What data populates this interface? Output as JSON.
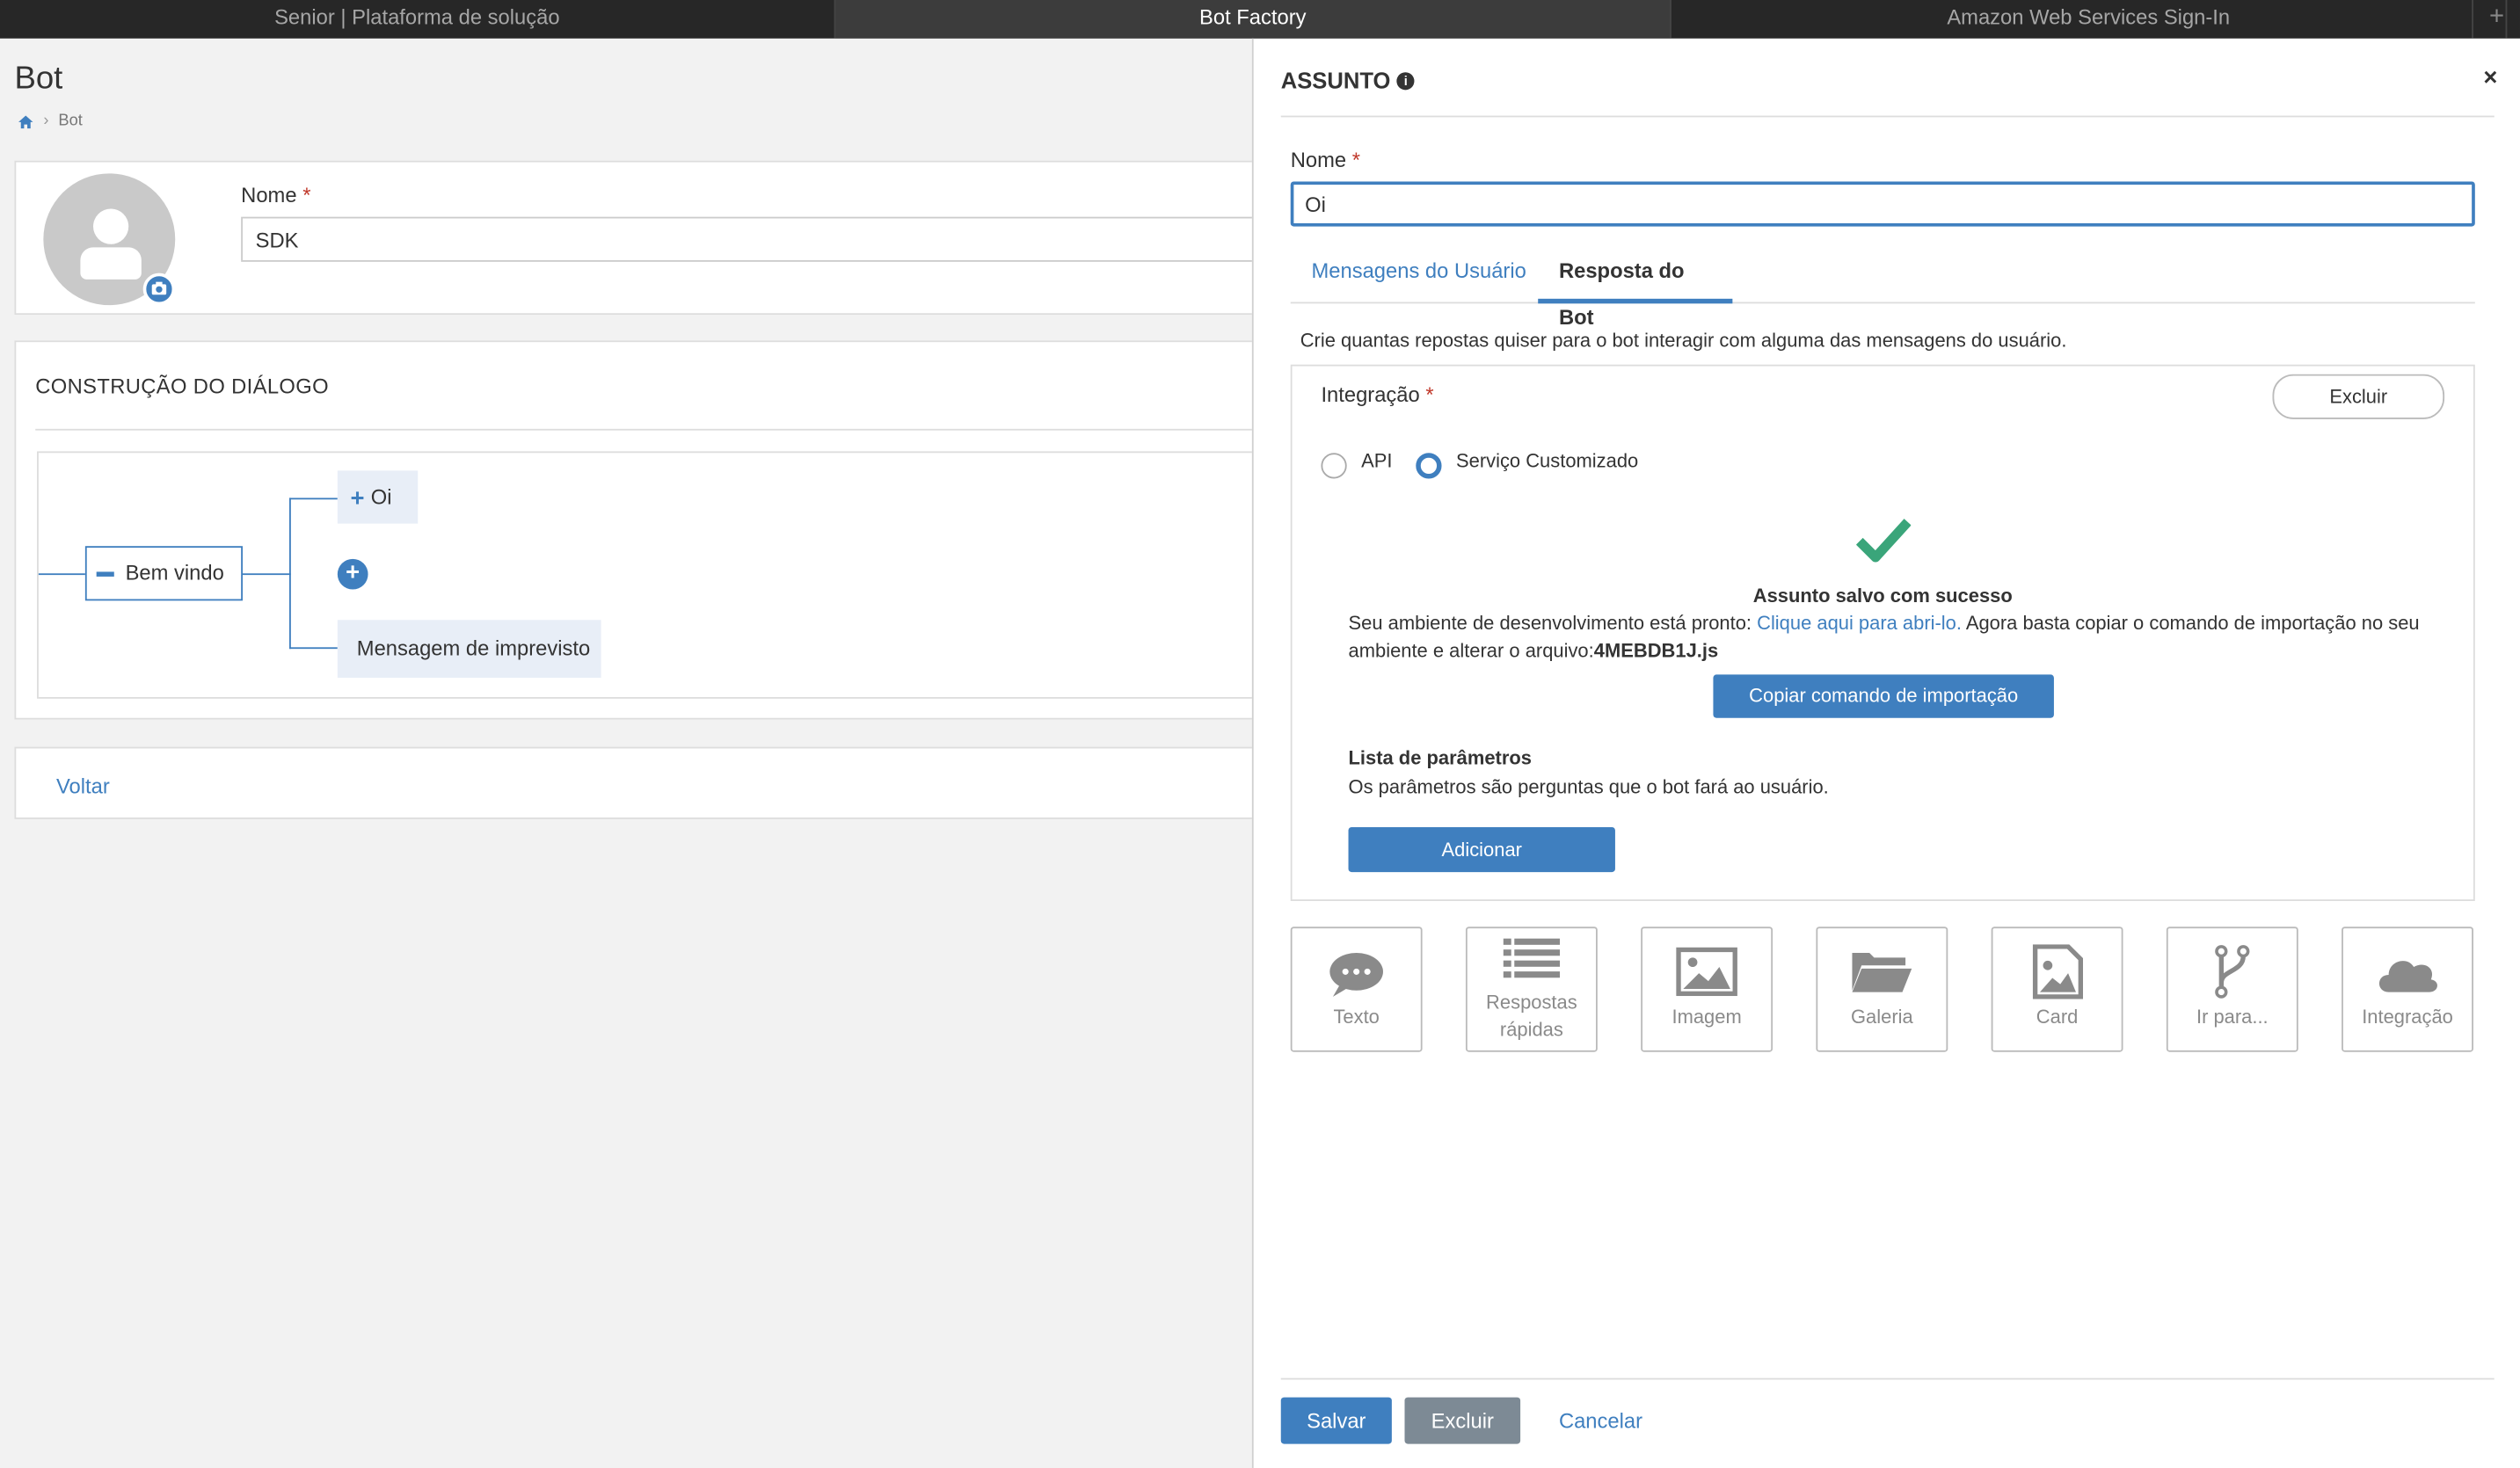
{
  "browser_tabs": [
    {
      "label": "Senior | Plataforma de solução",
      "active": false
    },
    {
      "label": "Bot Factory",
      "active": true
    },
    {
      "label": "Amazon Web Services Sign-In",
      "active": false
    }
  ],
  "new_tab": "+",
  "page": {
    "title": "Bot",
    "breadcrumb": [
      "Bot"
    ],
    "name_label": "Nome",
    "required": "*",
    "name_value": "SDK",
    "dialog_title": "CONSTRUÇÃO DO DIÁLOGO",
    "tree": {
      "root": "Bem vindo",
      "children": [
        "Oi",
        "Mensagem de imprevisto"
      ]
    },
    "back_link": "Voltar"
  },
  "drawer": {
    "title": "ASSUNTO",
    "close": "×",
    "name_label": "Nome",
    "required": "*",
    "name_value": "Oi",
    "tabs": [
      {
        "label": "Mensagens do Usuário",
        "active": false
      },
      {
        "label": "Resposta do Bot",
        "active": true
      }
    ],
    "description": "Crie quantas repostas quiser para o bot interagir com alguma das mensagens do usuário.",
    "integration": {
      "label": "Integração",
      "delete_btn": "Excluir",
      "options": [
        {
          "label": "API",
          "selected": false
        },
        {
          "label": "Serviço Customizado",
          "selected": true
        }
      ],
      "success_title": "Assunto salvo com sucesso",
      "message_pre": "Seu ambiente de desenvolvimento está pronto: ",
      "message_link": "Clique aqui para abri-lo.",
      "message_post": " Agora basta copiar o comando de importação no seu ambiente e alterar o arquivo:",
      "file": "4MEBDB1J.js",
      "copy_btn": "Copiar comando de importação",
      "params_title": "Lista de parâmetros",
      "params_desc": "Os parâmetros são perguntas que o bot fará ao usuário.",
      "add_btn": "Adicionar"
    },
    "response_types": [
      {
        "label": "Texto",
        "icon": "speech-bubble-icon"
      },
      {
        "label": "Respostas rápidas",
        "icon": "list-icon"
      },
      {
        "label": "Imagem",
        "icon": "image-icon"
      },
      {
        "label": "Galeria",
        "icon": "folder-open-icon"
      },
      {
        "label": "Card",
        "icon": "image-file-icon"
      },
      {
        "label": "Ir para...",
        "icon": "branch-icon"
      },
      {
        "label": "Integração",
        "icon": "cloud-icon"
      }
    ],
    "footer": {
      "save": "Salvar",
      "delete": "Excluir",
      "cancel": "Cancelar"
    }
  },
  "colors": {
    "accent": "#3f7fbf",
    "success": "#3aa57a",
    "danger": "#c0392b",
    "tabbar": "#272727"
  }
}
